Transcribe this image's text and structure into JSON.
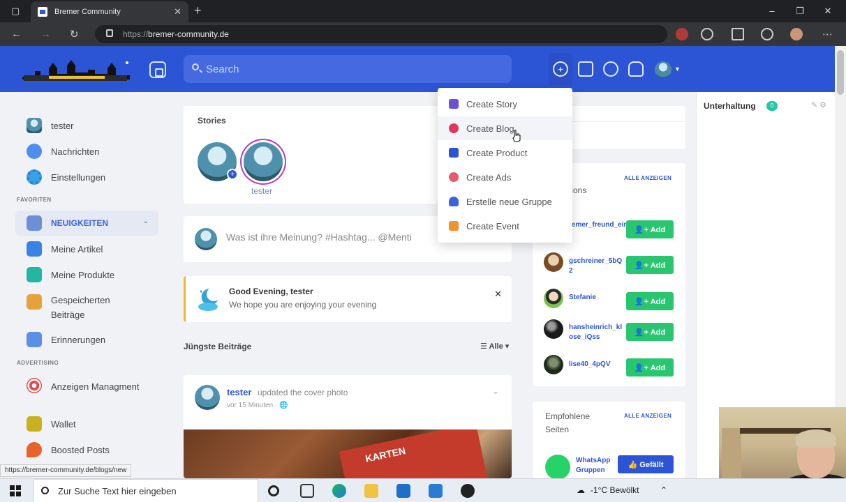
{
  "browser": {
    "tab_title": "Bremer Community",
    "url_scheme": "https://",
    "url_host": "bremer-community.de"
  },
  "header": {
    "search_placeholder": "Search"
  },
  "sidebar": {
    "items": [
      {
        "label": "tester"
      },
      {
        "label": "Nachrichten"
      },
      {
        "label": "Einstellungen"
      }
    ],
    "favoriten_title": "FAVORITEN",
    "favorites": [
      {
        "label": "NEUIGKEITEN"
      },
      {
        "label": "Meine Artikel"
      },
      {
        "label": "Meine Produkte"
      },
      {
        "label": "Gespeicherten Beiträge"
      },
      {
        "label": "Erinnerungen"
      }
    ],
    "advertising_title": "ADVERTISING",
    "advertising": [
      {
        "label": "Anzeigen Managment"
      },
      {
        "label": "Wallet"
      },
      {
        "label": "Boosted Posts"
      }
    ]
  },
  "stories": {
    "title": "Stories",
    "user_name": "tester"
  },
  "composer": {
    "placeholder": "Was ist ihre Meinung? #Hashtag... @Menti"
  },
  "greeting": {
    "title": "Good Evening, tester",
    "subtitle": "We hope you are enjoying your evening"
  },
  "feed": {
    "latest_title": "Jüngste Beiträge",
    "filter_label": "Alle",
    "post": {
      "author": "tester",
      "action": "updated the cover photo",
      "time": "vor 15 Minuten",
      "image_text": "KARTEN"
    }
  },
  "dropdown": {
    "items": [
      {
        "label": "Create Story",
        "icon": "story-icon",
        "color": "#6b4fd8"
      },
      {
        "label": "Create Blog",
        "icon": "blog-icon",
        "color": "#e2365a"
      },
      {
        "label": "Create Product",
        "icon": "cart-icon",
        "color": "#2c55d6"
      },
      {
        "label": "Create Ads",
        "icon": "ads-icon",
        "color": "#e85a6e"
      },
      {
        "label": "Erstelle neue Gruppe",
        "icon": "group-icon",
        "color": "#3b63d9"
      },
      {
        "label": "Create Event",
        "icon": "calendar-icon",
        "color": "#f0932b"
      }
    ]
  },
  "suggestions": {
    "title_partial": "tions",
    "see_all": "ALLE ANZEIGEN",
    "add_label": "Add",
    "people": [
      {
        "name": "remer_freund_eini"
      },
      {
        "name": "gschreiner_5bQ2"
      },
      {
        "name": "Stefanie"
      },
      {
        "name": "hansheinrich_klose_iQss"
      },
      {
        "name": "lise40_4pQV"
      }
    ]
  },
  "pages": {
    "title": "Empfohlene Seiten",
    "see_all": "ALLE ANZEIGEN",
    "page_name": "WhatsApp Gruppen",
    "follow_label": "Gefällt"
  },
  "chat": {
    "title": "Unterhaltung",
    "badge": "0"
  },
  "statusbar": {
    "link": "https://bremer-community.de/blogs/new"
  },
  "taskbar": {
    "search_text": "Zur Suche Text hier eingeben",
    "weather": "-1°C  Bewölkt"
  },
  "colors": {
    "brand": "#2c55d6",
    "add_green": "#28c76f"
  }
}
